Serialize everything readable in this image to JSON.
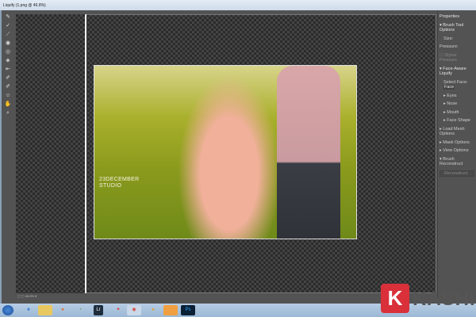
{
  "window": {
    "title": "Liquify (1.png @ 46.8%)",
    "zoom": "46.8%"
  },
  "tools": [
    "forward-warp",
    "reconstruct",
    "smooth",
    "twirl",
    "pucker",
    "bloat",
    "push-left",
    "freeze-mask",
    "thaw-mask",
    "face",
    "hand",
    "zoom"
  ],
  "watermark": {
    "line1": "23DECEMBER",
    "line2": "STUDIO"
  },
  "properties": {
    "title": "Properties",
    "brush_tool_options": "Brush Tool Options",
    "size": "Size:",
    "pressure": "Pressure:",
    "stylus_pressure": "Stylus Pressure",
    "face_aware": "Face-Aware Liquify",
    "select_face": "Select Face:",
    "select_face_value": "Face",
    "eyes": "Eyes",
    "nose": "Nose",
    "mouth": "Mouth",
    "face_shape": "Face Shape",
    "load_mesh": "Load Mesh Options",
    "mask_options": "Mask Options",
    "view_options": "View Options",
    "brush_reconstruct": "Brush Reconstruct",
    "reconstruct_btn": "Reconstruct"
  },
  "logo": {
    "letter": "K",
    "text": "KASHI"
  }
}
